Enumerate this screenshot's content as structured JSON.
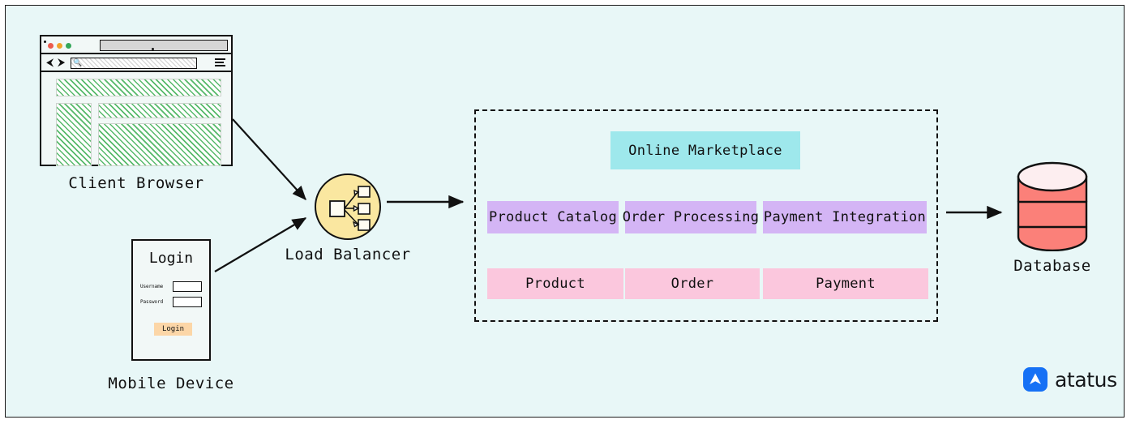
{
  "canvas": {
    "background_color": "#e8f7f7",
    "border_color": "#1b1b1b"
  },
  "nodes": {
    "client_browser": {
      "label": "Client Browser",
      "browser_chrome": {
        "traffic_lights": [
          "red-dot",
          "amber-dot",
          "green-dot"
        ],
        "back_arrow": "⮜",
        "forward_arrow": "⮞",
        "search_icon": "🔍",
        "menu_icon": "hamburger-icon"
      }
    },
    "mobile_device": {
      "label": "Mobile Device",
      "form": {
        "title": "Login",
        "username_label": "Username",
        "password_label": "Password",
        "submit_label": "Login",
        "submit_color": "#fcd6a7"
      }
    },
    "load_balancer": {
      "label": "Load Balancer",
      "fill_color": "#fae7a0"
    },
    "database": {
      "label": "Database",
      "fill_color": "#fb8079",
      "top_color": "#fdeef0"
    }
  },
  "container": {
    "marketplace": {
      "label": "Online Marketplace",
      "color": "#9ee8ec"
    },
    "services": {
      "color": "#d4b5f5",
      "items": [
        {
          "label": "Product Catalog"
        },
        {
          "label": "Order Processing"
        },
        {
          "label": "Payment Integration"
        }
      ]
    },
    "entities": {
      "color": "#fbc7dd",
      "items": [
        {
          "label": "Product"
        },
        {
          "label": "Order"
        },
        {
          "label": "Payment"
        }
      ]
    }
  },
  "connections": [
    {
      "from": "client-browser",
      "to": "load-balancer"
    },
    {
      "from": "mobile-device",
      "to": "load-balancer"
    },
    {
      "from": "load-balancer",
      "to": "application-container"
    },
    {
      "from": "application-container",
      "to": "database"
    }
  ],
  "branding": {
    "name": "atatus",
    "mark_color": "#1671f5"
  }
}
